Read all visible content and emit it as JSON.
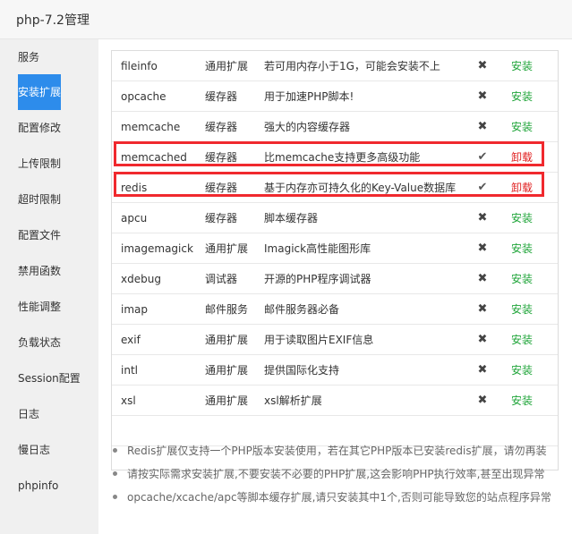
{
  "window": {
    "title": "php-7.2管理"
  },
  "sidebar": {
    "items": [
      {
        "label": "服务"
      },
      {
        "label": "安装扩展"
      },
      {
        "label": "配置修改"
      },
      {
        "label": "上传限制"
      },
      {
        "label": "超时限制"
      },
      {
        "label": "配置文件"
      },
      {
        "label": "禁用函数"
      },
      {
        "label": "性能调整"
      },
      {
        "label": "负载状态"
      },
      {
        "label": "Session配置"
      },
      {
        "label": "日志"
      },
      {
        "label": "慢日志"
      },
      {
        "label": "phpinfo"
      }
    ],
    "active_index": 1
  },
  "extensions": [
    {
      "name": "fileinfo",
      "type": "通用扩展",
      "desc": "若可用内存小于1G，可能会安装不上",
      "status": "✖",
      "installed": false,
      "action": "安装"
    },
    {
      "name": "opcache",
      "type": "缓存器",
      "desc": "用于加速PHP脚本!",
      "status": "✖",
      "installed": false,
      "action": "安装"
    },
    {
      "name": "memcache",
      "type": "缓存器",
      "desc": "强大的内容缓存器",
      "status": "✖",
      "installed": false,
      "action": "安装"
    },
    {
      "name": "memcached",
      "type": "缓存器",
      "desc": "比memcache支持更多高级功能",
      "status": "✔",
      "installed": true,
      "action": "卸载"
    },
    {
      "name": "redis",
      "type": "缓存器",
      "desc": "基于内存亦可持久化的Key-Value数据库",
      "status": "✔",
      "installed": true,
      "action": "卸载"
    },
    {
      "name": "apcu",
      "type": "缓存器",
      "desc": "脚本缓存器",
      "status": "✖",
      "installed": false,
      "action": "安装"
    },
    {
      "name": "imagemagick",
      "type": "通用扩展",
      "desc": "Imagick高性能图形库",
      "status": "✖",
      "installed": false,
      "action": "安装"
    },
    {
      "name": "xdebug",
      "type": "调试器",
      "desc": "开源的PHP程序调试器",
      "status": "✖",
      "installed": false,
      "action": "安装"
    },
    {
      "name": "imap",
      "type": "邮件服务",
      "desc": "邮件服务器必备",
      "status": "✖",
      "installed": false,
      "action": "安装"
    },
    {
      "name": "exif",
      "type": "通用扩展",
      "desc": "用于读取图片EXIF信息",
      "status": "✖",
      "installed": false,
      "action": "安装"
    },
    {
      "name": "intl",
      "type": "通用扩展",
      "desc": "提供国际化支持",
      "status": "✖",
      "installed": false,
      "action": "安装"
    },
    {
      "name": "xsl",
      "type": "通用扩展",
      "desc": "xsl解析扩展",
      "status": "✖",
      "installed": false,
      "action": "安装"
    }
  ],
  "highlighted_rows": [
    3,
    4
  ],
  "notes": [
    "Redis扩展仅支持一个PHP版本安装使用，若在其它PHP版本已安装redis扩展，请勿再装",
    "请按实际需求安装扩展,不要安装不必要的PHP扩展,这会影响PHP执行效率,甚至出现异常",
    "opcache/xcache/apc等脚本缓存扩展,请只安装其中1个,否则可能导致您的站点程序异常"
  ],
  "colors": {
    "active_nav": "#2d8ceb",
    "install": "#20a53a",
    "uninstall": "#e02020",
    "highlight_border": "#f0292e"
  }
}
